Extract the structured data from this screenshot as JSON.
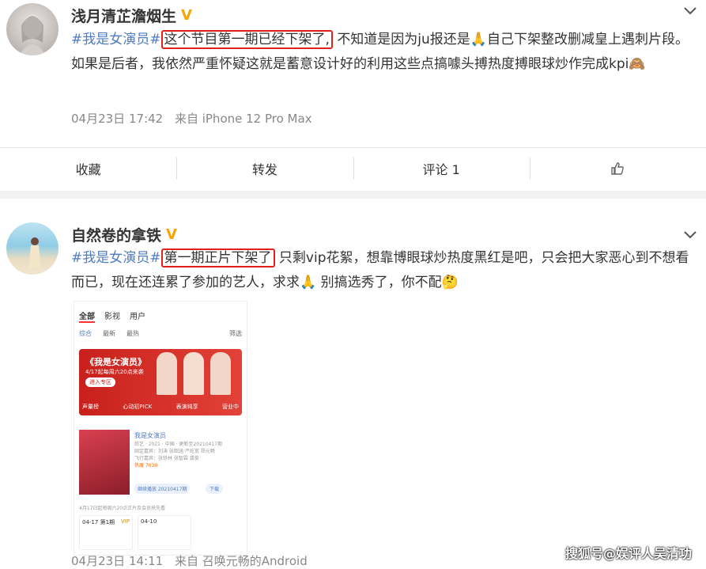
{
  "post1": {
    "username": "浅月清芷澹烟生",
    "text_topic": "#我是女演员#",
    "text_boxed": "这个节目第一期已经下架了,",
    "text_rest": "不知道是因为ju报还是🙏自己下架整改删减皇上遇刺片段。如果是后者，我依然严重怀疑这就是蓄意设计好的利用这些点搞噱头搏热度搏眼球炒作完成kpi🙈",
    "date": "04月23日 17:42",
    "source": "来自 iPhone 12 Pro Max",
    "actions": {
      "collect": "收藏",
      "repost": "转发",
      "comment": "评论 1"
    }
  },
  "post2": {
    "username": "自然卷的拿铁",
    "text_topic": "#我是女演员#",
    "text_boxed": "第一期正片下架了",
    "text_rest": "只剩vip花絮，想靠博眼球炒热度黑红是吧，只会把大家恶心到不想看而已，现在还连累了参加的艺人，求求🙏 别搞选秀了，你不配🤔",
    "date": "04月23日 14:11",
    "source": "来自 召唤元畅的Android",
    "screenshot": {
      "tabs": [
        "全部",
        "影视",
        "用户"
      ],
      "subtabs": [
        "综合",
        "最新",
        "最热"
      ],
      "filter": "筛选",
      "banner_title": "《我是女演员》",
      "banner_sub": "4/17起每周六20点来袭",
      "banner_btn": "进入专区",
      "banner_links": [
        "声量榜",
        "心动初PICK",
        "表演纯享",
        "营业中"
      ],
      "card_title": "我是女演员",
      "card_lines": [
        "综艺 · 2021 · 中国 · 更新至20210417期",
        "固定嘉宾：刘涛 张韶涵 严屹宽 郑元畅",
        "飞行嘉宾：张铁林 张智霖 龚俊"
      ],
      "card_hot": "热度 7030",
      "card_btn1": "继续播放 20210417期",
      "card_btn2": "下载",
      "note": "4月17日起每周六20点正片及会员抢先看",
      "ep1_date": "04-17 第1期",
      "ep1_badge": "VIP",
      "ep2_date": "04-10"
    }
  },
  "watermark": "搜狐号@娱评人吴清功",
  "colors": {
    "topic": "#4f7cc2",
    "highlight_box": "#e0211c",
    "verified": "#f7a400"
  }
}
